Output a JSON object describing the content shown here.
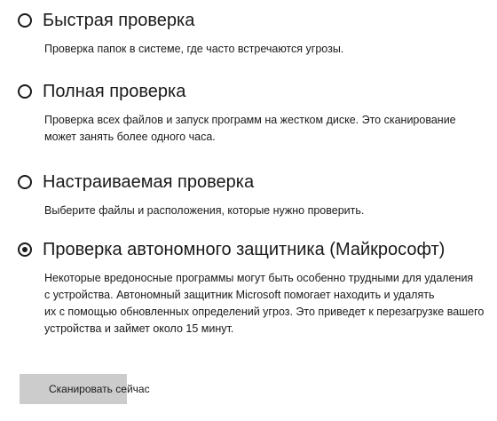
{
  "scan_options": [
    {
      "id": "quick",
      "title": "Быстрая проверка",
      "checked": false,
      "description_lines": [
        "Проверка папок в системе, где часто встречаются угрозы."
      ]
    },
    {
      "id": "full",
      "title": "Полная проверка",
      "checked": false,
      "description_lines": [
        "Проверка всех файлов и запуск программ на жестком диске. Это сканирование",
        "может занять более одного часа."
      ]
    },
    {
      "id": "custom",
      "title": "Настраиваемая проверка",
      "checked": false,
      "description_lines": [
        "Выберите файлы и расположения, которые нужно проверить."
      ]
    },
    {
      "id": "offline",
      "title": "Проверка автономного защитника (Майкрософт)",
      "checked": true,
      "description_lines": [
        "Некоторые вредоносные программы могут быть особенно трудными для удаления",
        "с устройства. Автономный защитник Microsoft помогает находить и удалять",
        "их с помощью обновленных определений угроз. Это приведет к перезагрузке вашего",
        "устройства и займет около 15 минут."
      ]
    }
  ],
  "scan_button": {
    "label": "Сканировать сейчас"
  }
}
